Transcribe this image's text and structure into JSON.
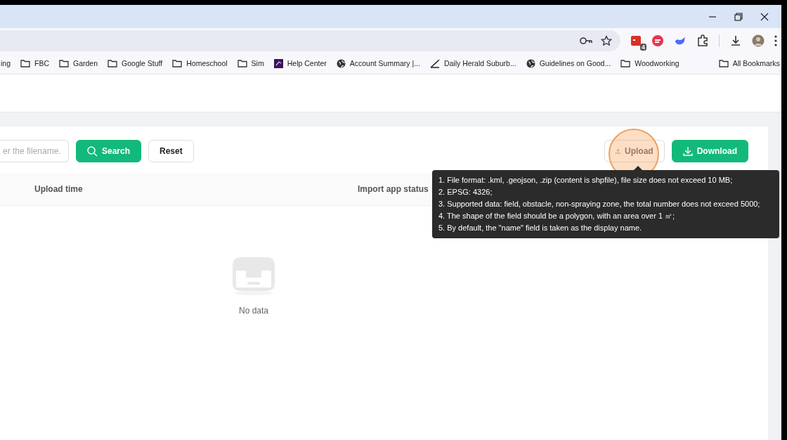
{
  "toolbar": {
    "extensions": [
      {
        "kind": "calendar",
        "badge": "4"
      },
      {
        "kind": "red"
      },
      {
        "kind": "whale"
      },
      {
        "kind": "puzzle"
      }
    ]
  },
  "bookmarks": [
    {
      "label": "ing",
      "kind": "none"
    },
    {
      "label": "FBC",
      "kind": "folder"
    },
    {
      "label": "Garden",
      "kind": "folder"
    },
    {
      "label": "Google Stuff",
      "kind": "folder"
    },
    {
      "label": "Homeschool",
      "kind": "folder"
    },
    {
      "label": "Sim",
      "kind": "folder"
    },
    {
      "label": "Help Center",
      "kind": "app"
    },
    {
      "label": "Account Summary |...",
      "kind": "globe"
    },
    {
      "label": "Daily Herald Suburb...",
      "kind": "herald"
    },
    {
      "label": "Guidelines on Good...",
      "kind": "globe"
    },
    {
      "label": "Woodworking",
      "kind": "folder"
    }
  ],
  "all_bookmarks": "All Bookmarks",
  "filter": {
    "placeholder": "er the filename.",
    "search": "Search",
    "reset": "Reset",
    "upload": "Upload",
    "download": "Download"
  },
  "table": {
    "columns": [
      "Upload time",
      "Import app status"
    ],
    "empty": "No data"
  },
  "tooltip": [
    "1. File format: .kml, .geojson, .zip (content is shpfile), file size does not exceed 10 MB;",
    "2. EPSG: 4326;",
    "3. Supported data: field, obstacle, non-spraying zone, the total number does not exceed 5000;",
    "4. The shape of the field should be a polygon, with an area over 1 ㎡;",
    "5. By default, the \"name\" field is taken as the display name."
  ]
}
